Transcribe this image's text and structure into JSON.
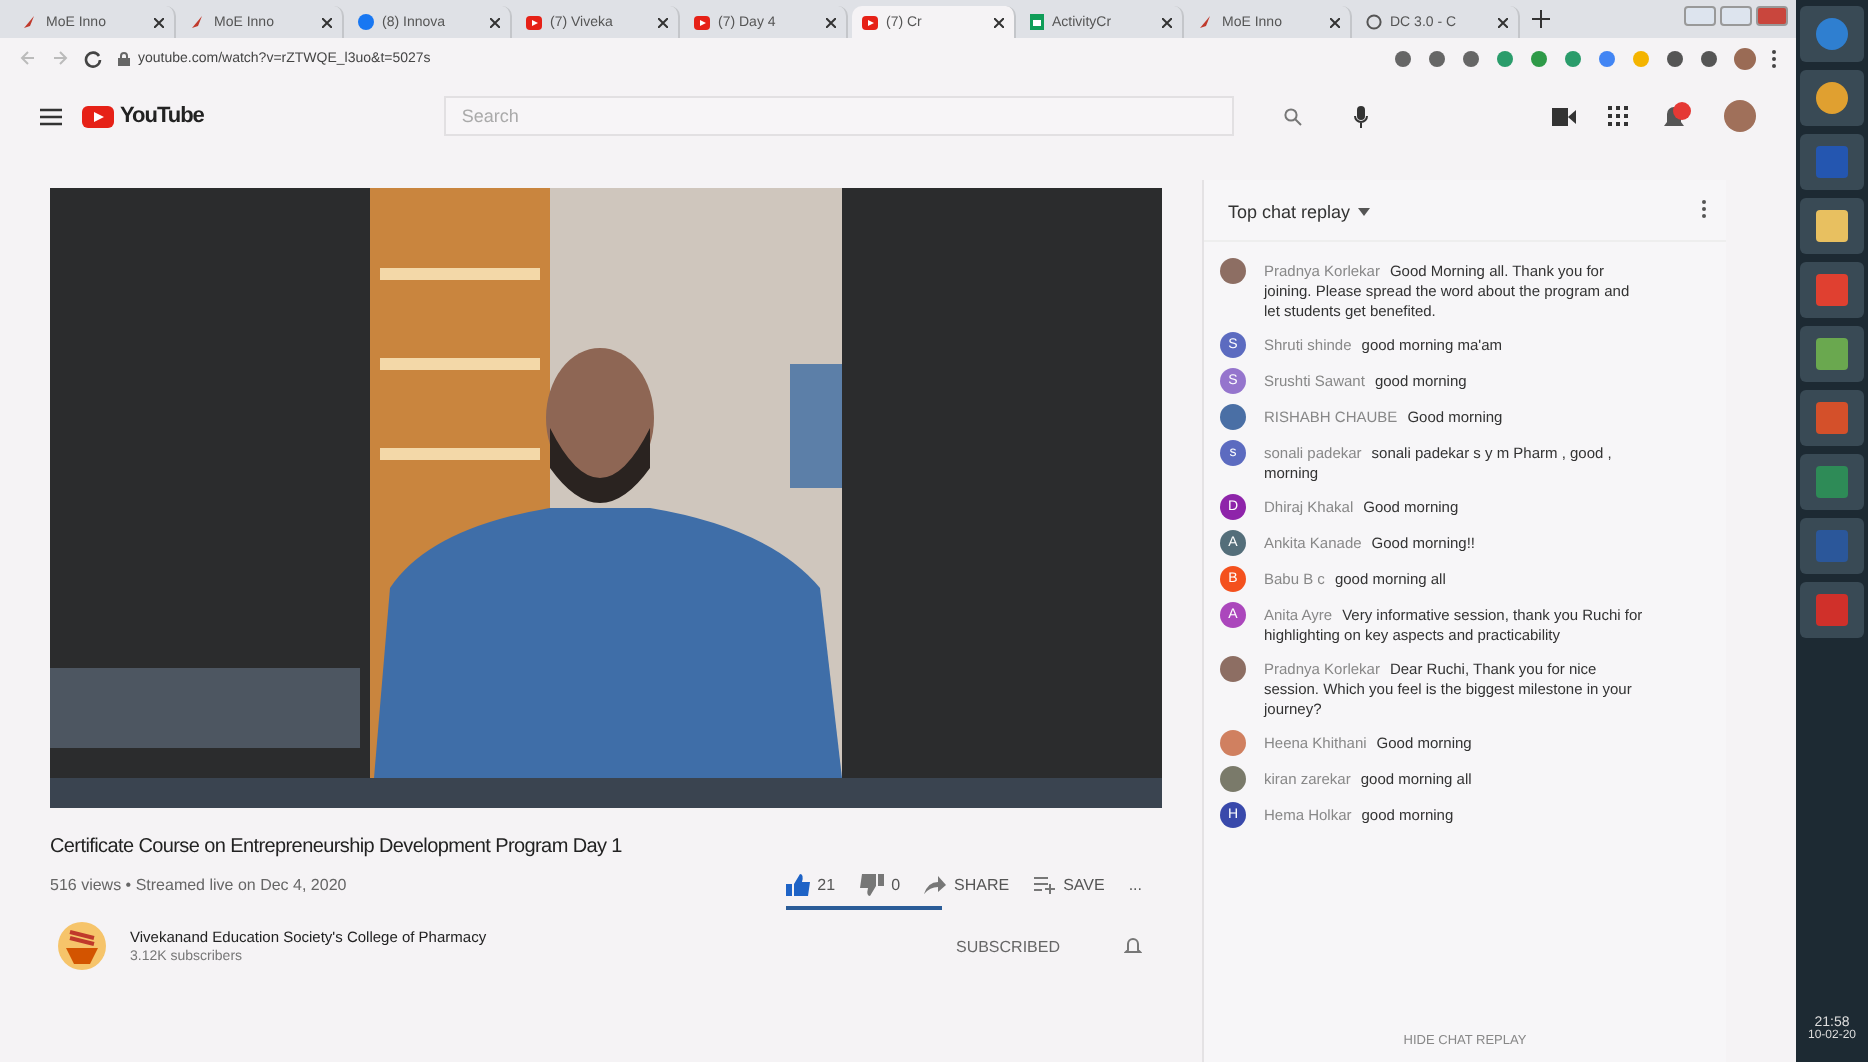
{
  "browser": {
    "tabs": [
      {
        "label": "MoE Inno",
        "kind": "moe",
        "selected": false
      },
      {
        "label": "MoE Inno",
        "kind": "moe",
        "selected": false
      },
      {
        "label": "(8) Innova",
        "kind": "facebook",
        "selected": false
      },
      {
        "label": "(7) Viveka",
        "kind": "youtube",
        "selected": false
      },
      {
        "label": "(7) Day 4",
        "kind": "youtube",
        "selected": false
      },
      {
        "label": "(7) Cr",
        "kind": "youtube",
        "selected": true
      },
      {
        "label": "ActivityCr",
        "kind": "sheets",
        "selected": false
      },
      {
        "label": "MoE Inno",
        "kind": "moe",
        "selected": false
      },
      {
        "label": "DC 3.0 - C",
        "kind": "globe",
        "selected": false
      }
    ],
    "url": "youtube.com/watch?v=rZTWQE_l3uo&t=5027s"
  },
  "youtube": {
    "logo": "YouTube",
    "search": {
      "placeholder": "Search"
    }
  },
  "video": {
    "title": "Certificate Course on Entrepreneurship Development Program Day 1",
    "meta": "516 views • Streamed live on Dec 4, 2020",
    "likes": "21",
    "liked": true,
    "dislikes": "0",
    "sentiment": {
      "level": 1
    },
    "share": "SHARE",
    "save": "SAVE",
    "more": "...",
    "channel": {
      "name": "Vivekanand Education Society's College of Pharmacy",
      "subscribers": "3.12K subscribers",
      "subscribe": "SUBSCRIBED"
    }
  },
  "chat": {
    "title": "Top chat replay",
    "messages": [
      {
        "author": "Pradnya Korlekar",
        "text": "Good Morning all. Thank you for joining. Please spread the word about the program and let students get benefited."
      },
      {
        "author": "Shruti shinde",
        "text": "good morning ma'am",
        "avatar": {
          "kind": "letter",
          "letter": "S",
          "color": "#5c6bc0"
        }
      },
      {
        "author": "Srushti Sawant",
        "text": "good morning",
        "avatar": {
          "kind": "letter",
          "letter": "S",
          "color": "#9575cd"
        }
      },
      {
        "author": "RISHABH CHAUBE",
        "text": "Good morning"
      },
      {
        "author": "sonali padekar",
        "text": "sonali padekar s y m Pharm , good , morning",
        "avatar": {
          "kind": "letter",
          "letter": "s",
          "color": "#5c6bc0"
        }
      },
      {
        "author": "Dhiraj Khakal",
        "text": "Good morning",
        "avatar": {
          "kind": "letter",
          "letter": "D",
          "color": "#8e24aa"
        }
      },
      {
        "author": "Ankita Kanade",
        "text": "Good morning!!",
        "avatar": {
          "kind": "letter",
          "letter": "A",
          "color": "#546e7a"
        }
      },
      {
        "author": "Babu B c",
        "text": "good morning all",
        "avatar": {
          "kind": "letter",
          "letter": "B",
          "color": "#f4511e"
        }
      },
      {
        "author": "Anita Ayre",
        "text": "Very informative session, thank you Ruchi for highlighting on key aspects and practicability",
        "avatar": {
          "kind": "letter",
          "letter": "A",
          "color": "#ab47bc"
        }
      },
      {
        "author": "Pradnya Korlekar",
        "text": "Dear Ruchi, Thank you for nice session. Which you feel is the biggest milestone in your journey?"
      },
      {
        "author": "Heena Khithani",
        "text": "Good morning"
      },
      {
        "author": "kiran zarekar",
        "text": "good morning all"
      },
      {
        "author": "Hema Holkar",
        "text": "good morning",
        "avatar": {
          "kind": "letter",
          "letter": "H",
          "color": "#3949ab"
        }
      }
    ],
    "hide": "HIDE CHAT REPLAY"
  },
  "taskbar": {
    "time": "21:58",
    "date": "10-02-20"
  }
}
